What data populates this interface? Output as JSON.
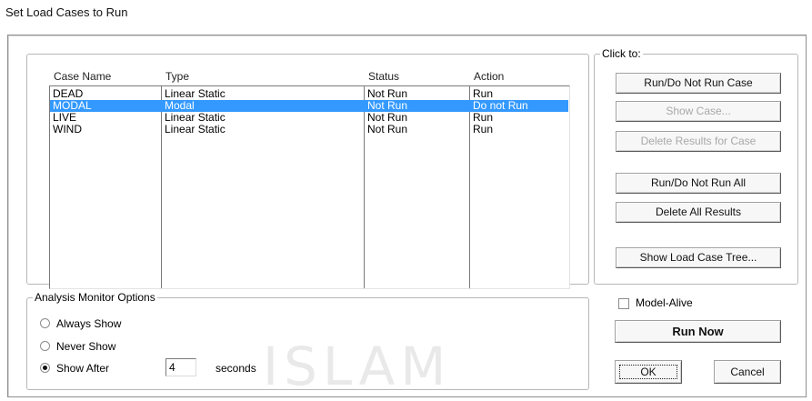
{
  "window": {
    "title": "Set Load Cases to Run"
  },
  "cases": {
    "columns": {
      "name": "Case Name",
      "type": "Type",
      "status": "Status",
      "action": "Action"
    },
    "rows": [
      {
        "name": "DEAD",
        "type": "Linear Static",
        "status": "Not Run",
        "action": "Run"
      },
      {
        "name": "MODAL",
        "type": "Modal",
        "status": "Not Run",
        "action": "Do not Run"
      },
      {
        "name": "LIVE",
        "type": "Linear Static",
        "status": "Not Run",
        "action": "Run"
      },
      {
        "name": "WIND",
        "type": "Linear Static",
        "status": "Not Run",
        "action": "Run"
      }
    ],
    "selected_index": 1
  },
  "click_to": {
    "label": "Click to:",
    "run_do_not_run_case": "Run/Do Not Run Case",
    "show_case": "Show Case...",
    "delete_results_for_case": "Delete Results for Case",
    "run_do_not_run_all": "Run/Do Not Run All",
    "delete_all_results": "Delete All Results",
    "show_load_case_tree": "Show Load Case Tree..."
  },
  "monitor": {
    "label": "Analysis Monitor Options",
    "always_show": "Always Show",
    "never_show": "Never Show",
    "show_after": "Show After",
    "seconds_value": "4",
    "seconds_label": "seconds",
    "selected": "show_after"
  },
  "model_alive": {
    "label": "Model-Alive",
    "checked": false
  },
  "actions": {
    "run_now": "Run Now",
    "ok": "OK",
    "cancel": "Cancel"
  },
  "watermark": "ISLAM",
  "colors": {
    "selection": "#3399ff",
    "disabled_text": "#a8a8a8"
  }
}
